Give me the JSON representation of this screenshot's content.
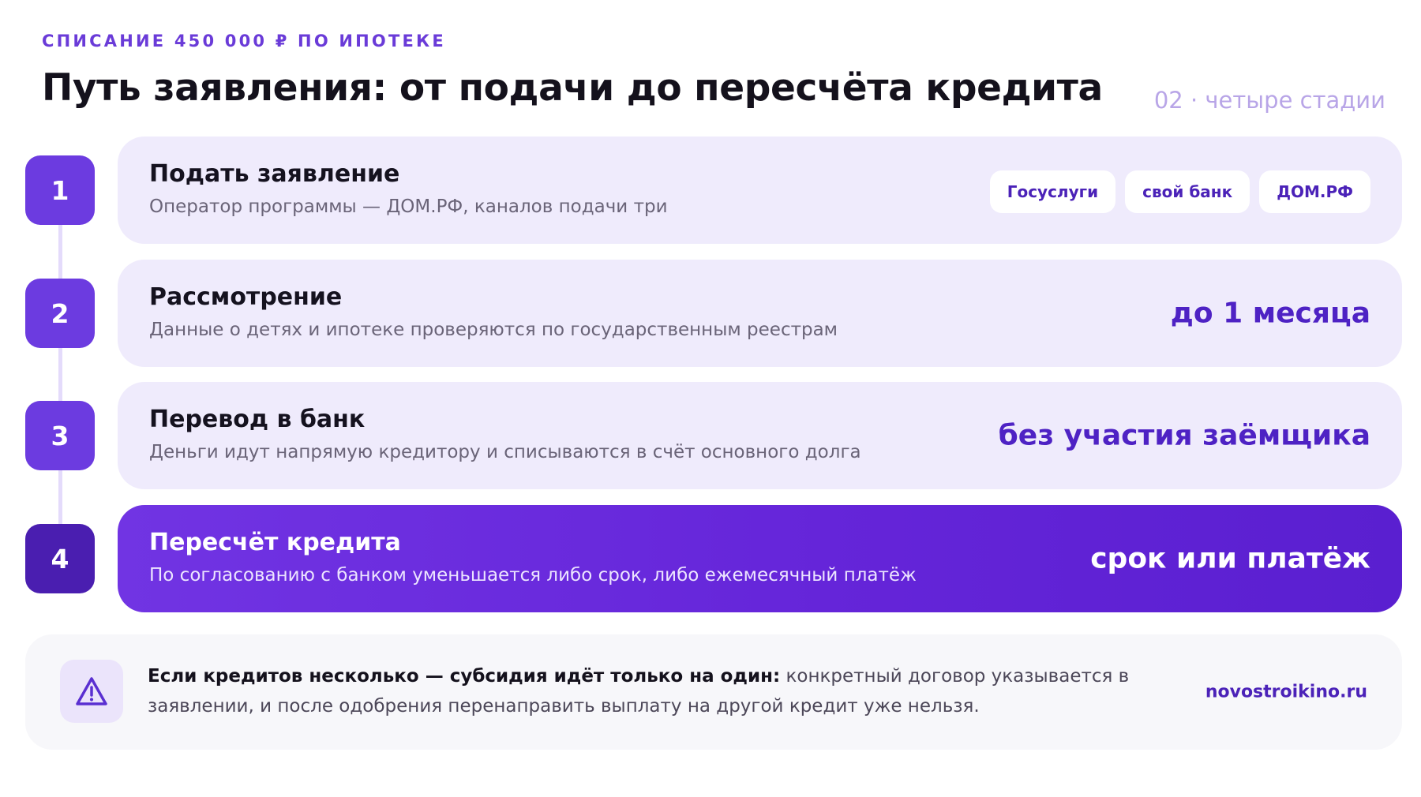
{
  "header": {
    "kicker": "СПИСАНИЕ 450 000 ₽ ПО ИПОТЕКЕ",
    "title": "Путь заявления: от подачи до пересчёта кредита",
    "slide_tag": "02 · четыре стадии"
  },
  "steps": [
    {
      "number": "1",
      "title": "Подать заявление",
      "description": "Оператор программы — ДОМ.РФ, каналов подачи три",
      "channels": [
        "Госуслуги",
        "свой банк",
        "ДОМ.РФ"
      ]
    },
    {
      "number": "2",
      "title": "Рассмотрение",
      "description": "Данные о детях и ипотеке проверяются по государственным реестрам",
      "value": "до 1 месяца"
    },
    {
      "number": "3",
      "title": "Перевод в банк",
      "description": "Деньги идут напрямую кредитору и списываются в счёт основного долга",
      "value": "без участия заёмщика"
    },
    {
      "number": "4",
      "title": "Пересчёт кредита",
      "description": "По согласованию с банком уменьшается либо срок, либо ежемесячный платёж",
      "value": "срок или платёж"
    }
  ],
  "note": {
    "icon": "warning-triangle-icon",
    "strong": "Если кредитов несколько — субсидия идёт только на один:",
    "text": " конкретный договор указывается в заявлении, и после одобрения перенаправить выплату на другой кредит уже нельзя.",
    "site": "novostroikino.ru"
  },
  "colors": {
    "accent": "#6c3be0",
    "accent_dark": "#4a1eb0",
    "card_bg": "#efebfc",
    "value_text": "#4e22c4"
  }
}
